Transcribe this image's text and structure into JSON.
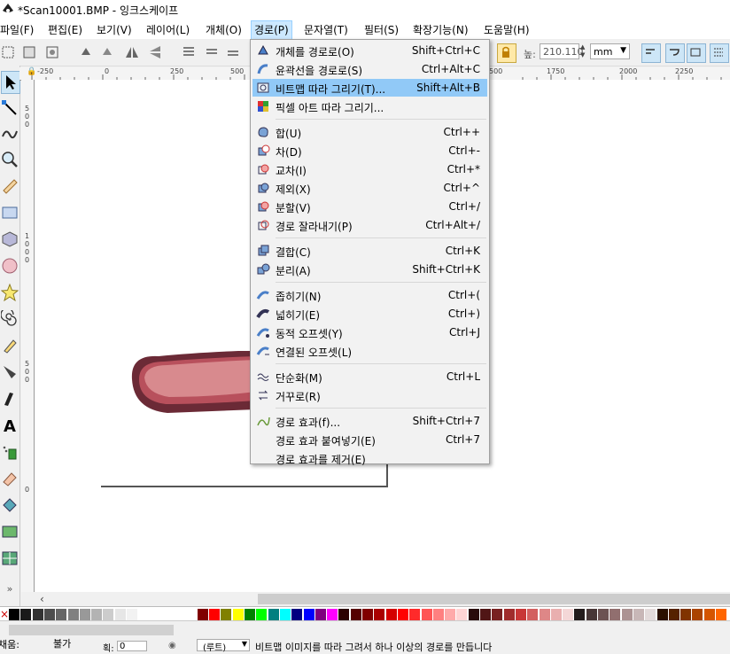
{
  "window": {
    "title": "*Scan10001.BMP - 잉크스케이프"
  },
  "menubar": {
    "items": [
      "파일(F)",
      "편집(E)",
      "보기(V)",
      "레이어(L)",
      "개체(O)",
      "경로(P)",
      "문자열(T)",
      "필터(S)",
      "확장기능(N)",
      "도움말(H)"
    ],
    "active_index": 5
  },
  "toolbar": {
    "height_label": "높:",
    "height_value": "210.110",
    "unit": "mm"
  },
  "ruler": {
    "h_labels": [
      "-250",
      "0",
      "250",
      "500",
      "500",
      "1750",
      "2000",
      "2250"
    ],
    "v_labels": [
      "5\n0\n0",
      "1\n0\n0\n0",
      "5\n0\n0",
      "0"
    ]
  },
  "path_menu": {
    "groups": [
      [
        {
          "label": "개체를 경로로(O)",
          "shortcut": "Shift+Ctrl+C",
          "icon": "object-to-path-icon"
        },
        {
          "label": "윤곽선을 경로로(S)",
          "shortcut": "Ctrl+Alt+C",
          "icon": "stroke-to-path-icon"
        },
        {
          "label": "비트맵 따라 그리기(T)...",
          "shortcut": "Shift+Alt+B",
          "icon": "trace-bitmap-icon",
          "highlighted": true
        },
        {
          "label": "픽셀 아트 따라 그리기...",
          "shortcut": "",
          "icon": "trace-pixel-art-icon"
        }
      ],
      [
        {
          "label": "합(U)",
          "shortcut": "Ctrl++",
          "icon": "union-icon"
        },
        {
          "label": "차(D)",
          "shortcut": "Ctrl+-",
          "icon": "difference-icon"
        },
        {
          "label": "교차(I)",
          "shortcut": "Ctrl+*",
          "icon": "intersection-icon"
        },
        {
          "label": "제외(X)",
          "shortcut": "Ctrl+^",
          "icon": "exclusion-icon"
        },
        {
          "label": "분할(V)",
          "shortcut": "Ctrl+/",
          "icon": "division-icon"
        },
        {
          "label": "경로 잘라내기(P)",
          "shortcut": "Ctrl+Alt+/",
          "icon": "cut-path-icon"
        }
      ],
      [
        {
          "label": "결합(C)",
          "shortcut": "Ctrl+K",
          "icon": "combine-icon"
        },
        {
          "label": "분리(A)",
          "shortcut": "Shift+Ctrl+K",
          "icon": "break-apart-icon"
        }
      ],
      [
        {
          "label": "좁히기(N)",
          "shortcut": "Ctrl+(",
          "icon": "inset-icon"
        },
        {
          "label": "넓히기(E)",
          "shortcut": "Ctrl+)",
          "icon": "outset-icon"
        },
        {
          "label": "동적 오프셋(Y)",
          "shortcut": "Ctrl+J",
          "icon": "dynamic-offset-icon"
        },
        {
          "label": "연결된 오프셋(L)",
          "shortcut": "",
          "icon": "linked-offset-icon"
        }
      ],
      [
        {
          "label": "단순화(M)",
          "shortcut": "Ctrl+L",
          "icon": "simplify-icon"
        },
        {
          "label": "거꾸로(R)",
          "shortcut": "",
          "icon": "reverse-icon"
        }
      ],
      [
        {
          "label": "경로 효과(f)...",
          "shortcut": "Shift+Ctrl+7",
          "icon": "path-effects-icon"
        },
        {
          "label": "경로 효과 붙여넣기(E)",
          "shortcut": "Ctrl+7",
          "icon": ""
        },
        {
          "label": "경로 효과를 제거(E)",
          "shortcut": "",
          "icon": ""
        }
      ]
    ]
  },
  "statusbar": {
    "fill_label": "채움:",
    "fill_value": "불가",
    "stroke_label": "획:",
    "stroke_value": "0",
    "layer": "(루트)",
    "message": "비트맵 이미지를 따라 그려서 하나 이상의 경로를 만듭니다"
  },
  "palette_colors": [
    "#000000",
    "#1a1a1a",
    "#333333",
    "#4d4d4d",
    "#666666",
    "#808080",
    "#999999",
    "#b3b3b3",
    "#cccccc",
    "#e6e6e6",
    "#f2f2f2",
    "#ffffff",
    "#ffffff",
    "#ffffff",
    "#ffffff",
    "#ffffff",
    "#800000",
    "#ff0000",
    "#808000",
    "#ffff00",
    "#008000",
    "#00ff00",
    "#008080",
    "#00ffff",
    "#000080",
    "#0000ff",
    "#800080",
    "#ff00ff",
    "#2b0000",
    "#550000",
    "#800000",
    "#aa0000",
    "#d40000",
    "#ff0000",
    "#ff2a2a",
    "#ff5555",
    "#ff8080",
    "#ffaaaa",
    "#ffd5d5",
    "#280b0b",
    "#501616",
    "#782121",
    "#a02c2c",
    "#c83737",
    "#d35f5f",
    "#de8787",
    "#e9afaf",
    "#f4d7d7",
    "#241c1c",
    "#483737",
    "#6c5353",
    "#916f6f",
    "#ac9393",
    "#c8b7b7",
    "#e3dbdb",
    "#2b1100",
    "#552200",
    "#803300",
    "#aa4400",
    "#d45500",
    "#ff6600"
  ]
}
